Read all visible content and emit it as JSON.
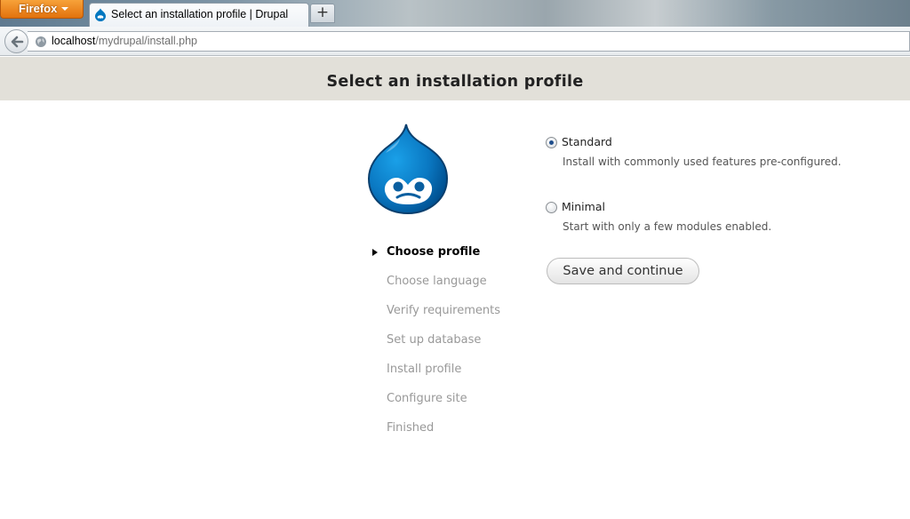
{
  "browser": {
    "menu_button": "Firefox",
    "tab_title": "Select an installation profile | Drupal",
    "new_tab_symbol": "+",
    "url_host": "localhost",
    "url_path": "/mydrupal/install.php",
    "icons": {
      "back": "back-arrow-icon",
      "site": "globe-icon",
      "favicon": "drupal-favicon-icon"
    }
  },
  "page": {
    "title": "Select an installation profile",
    "logo": "drupal-logo-icon"
  },
  "steps": [
    {
      "label": "Choose profile",
      "active": true
    },
    {
      "label": "Choose language",
      "active": false
    },
    {
      "label": "Verify requirements",
      "active": false
    },
    {
      "label": "Set up database",
      "active": false
    },
    {
      "label": "Install profile",
      "active": false
    },
    {
      "label": "Configure site",
      "active": false
    },
    {
      "label": "Finished",
      "active": false
    }
  ],
  "profiles": [
    {
      "label": "Standard",
      "description": "Install with commonly used features pre-configured.",
      "selected": true
    },
    {
      "label": "Minimal",
      "description": "Start with only a few modules enabled.",
      "selected": false
    }
  ],
  "actions": {
    "save_label": "Save and continue"
  },
  "colors": {
    "header_bg": "#e2e0d9",
    "drupal_blue": "#0077c0",
    "firefox_orange": "#e66000",
    "step_inactive": "#999999"
  }
}
